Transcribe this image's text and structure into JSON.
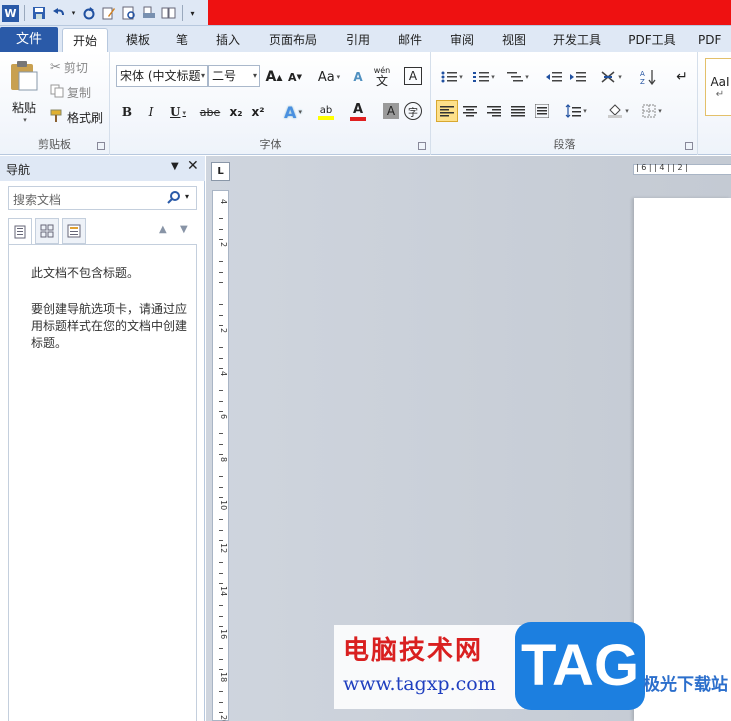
{
  "qat": {
    "app_icon": "W"
  },
  "tabs": {
    "file": "文件",
    "items": [
      "开始",
      "模板",
      "笔",
      "插入",
      "页面布局",
      "引用",
      "邮件",
      "审阅",
      "视图",
      "开发工具",
      "PDF工具",
      "PDF工"
    ]
  },
  "clipboard": {
    "paste": "粘贴",
    "cut": "剪切",
    "copy": "复制",
    "format_painter": "格式刷",
    "label": "剪贴板"
  },
  "font": {
    "name": "宋体 (中文标题",
    "size": "二号",
    "bold": "B",
    "italic": "I",
    "underline": "U",
    "strike": "abe",
    "subscript": "x₂",
    "superscript": "x²",
    "grow": "A",
    "shrink": "A",
    "case": "Aa",
    "clear": "A",
    "phonetic_top": "wén",
    "phonetic_bottom": "文",
    "char_border": "A",
    "char_shading": "A",
    "enclose": "字",
    "label": "字体"
  },
  "paragraph": {
    "label": "段落"
  },
  "styles": {
    "preview": "AaI"
  },
  "nav": {
    "title": "导航",
    "search_placeholder": "搜索文档",
    "msg1": "此文档不包含标题。",
    "msg2": "要创建导航选项卡，请通过应用标题样式在您的文档中创建标题。"
  },
  "ruler": {
    "corner": "L",
    "vticks": [
      "4",
      "2",
      "",
      "2",
      "4",
      "6",
      "8",
      "10",
      "12",
      "14",
      "16",
      "18",
      "20"
    ],
    "hticks": "| 6 | | 4 | | 2 |"
  },
  "watermark": {
    "cn": "电脑技术网",
    "url": "www.tagxp.com",
    "tag": "TAG",
    "sub": "极光下载站"
  },
  "colors": {
    "file_tab": "#2a5aa8",
    "title_red": "#ee1111",
    "ribbon_bg": "#dfe8f5",
    "highlight": "#ffff00",
    "font_color": "#e02020"
  }
}
